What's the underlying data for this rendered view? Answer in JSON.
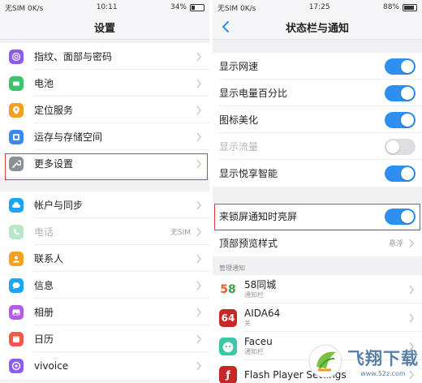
{
  "left": {
    "status": {
      "carrier": "无SIM 0K/s",
      "time": "10:11",
      "battery": "34%"
    },
    "title": "设置",
    "groups": [
      [
        {
          "label": "指纹、面部与密码",
          "icon": "fingerprint-icon",
          "color": "#8a5cf0"
        },
        {
          "label": "电池",
          "icon": "battery-icon",
          "color": "#3cc46a"
        },
        {
          "label": "定位服务",
          "icon": "location-icon",
          "color": "#f4a020"
        },
        {
          "label": "运存与存储空间",
          "icon": "storage-icon",
          "color": "#3a88f2"
        },
        {
          "label": "更多设置",
          "icon": "wrench-icon",
          "color": "#8a8f98"
        }
      ],
      [
        {
          "label": "帐户与同步",
          "icon": "cloud-icon",
          "color": "#1ba5f5"
        },
        {
          "label": "电话",
          "icon": "phone-icon",
          "color": "#b8e8c8",
          "aux": "无SIM"
        },
        {
          "label": "联系人",
          "icon": "contacts-icon",
          "color": "#f4a020"
        },
        {
          "label": "信息",
          "icon": "message-icon",
          "color": "#1ba5f5"
        },
        {
          "label": "相册",
          "icon": "album-icon",
          "color": "#b35ce8"
        },
        {
          "label": "日历",
          "icon": "calendar-icon",
          "color": "#f25a4b"
        },
        {
          "label": "vivoice",
          "icon": "vivoice-icon",
          "color": "#8a5cf0"
        }
      ]
    ]
  },
  "right": {
    "status": {
      "carrier": "无SIM 0K/s",
      "time": "17:25",
      "battery": "88%"
    },
    "title": "状态栏与通知",
    "toggles": [
      {
        "label": "显示网速",
        "on": true
      },
      {
        "label": "显示电量百分比",
        "on": true
      },
      {
        "label": "图标美化",
        "on": true
      },
      {
        "label": "显示流量",
        "on": false
      },
      {
        "label": "显示悦享智能",
        "on": true
      }
    ],
    "lock_row": {
      "label": "来锁屏通知时亮屏",
      "on": true
    },
    "top_preview": {
      "label": "顶部预览样式",
      "value": "悬浮"
    },
    "section_header": "管理通知",
    "apps": [
      {
        "name": "58同城",
        "sub": "通知栏",
        "icon": "58-icon"
      },
      {
        "name": "AIDA64",
        "sub": "关",
        "icon": "aida64-icon"
      },
      {
        "name": "Faceu",
        "sub": "通知栏",
        "icon": "faceu-icon"
      },
      {
        "name": "Flash Player Settings",
        "sub": "",
        "icon": "flash-icon"
      }
    ]
  },
  "watermark": {
    "title": "飞翔下载",
    "url": "www.52z.com"
  },
  "colors": {
    "accent": "#2e8ff0",
    "highlight": "#e53935"
  }
}
